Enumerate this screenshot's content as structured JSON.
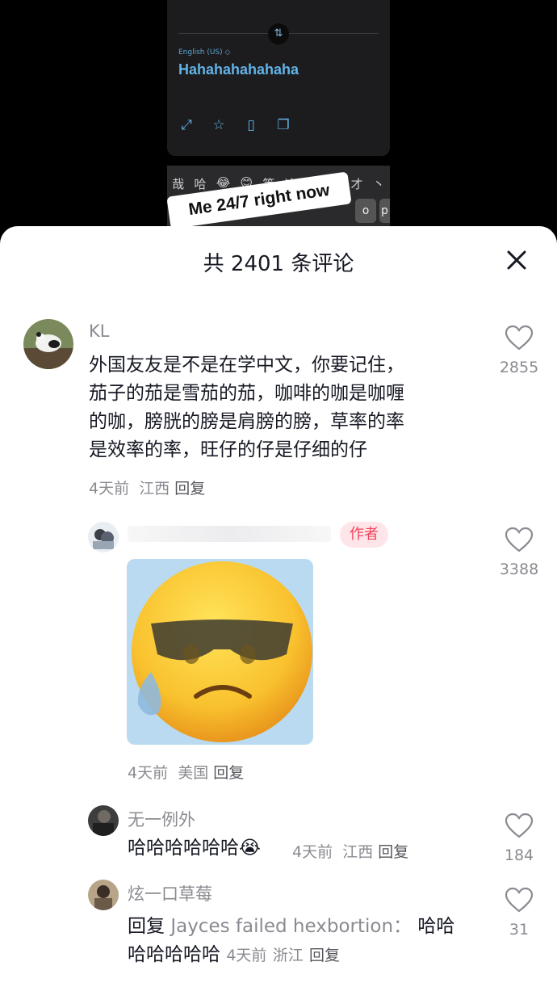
{
  "video": {
    "language_label": "English (US) ◇",
    "translated_text": "Hahahahahahaha",
    "caption": "Me 24/7 right now",
    "keyboard_candidates": [
      "哉",
      "哈",
      "😂",
      "😊",
      "等",
      "这",
      "啊",
      "你",
      "才",
      "丶"
    ],
    "keys": [
      "o",
      "p"
    ]
  },
  "comments_sheet": {
    "title": "共 2401 条评论",
    "close_icon": "close-icon"
  },
  "comments": [
    {
      "username": "KL",
      "text": "外国友友是不是在学中文，你要记住，茄子的茄是雪茄的茄，咖啡的咖是咖喱的咖，膀胱的膀是肩膀的膀，草率的率是效率的率，旺仔的仔是仔细的仔",
      "lines": [
        "外国友友是不是在学中文，你要记住，",
        "茄子的茄是雪茄的茄，咖啡的咖是咖喱",
        "的咖，膀胱的膀是肩膀的膀，草率的率",
        "是效率的率，旺仔的仔是仔细的仔"
      ],
      "time": "4天前",
      "location": "江西",
      "reply": "回复",
      "likes": "2855"
    },
    {
      "username": "",
      "badge": "作者",
      "sticker": "crying-sunglasses-emoji",
      "time": "4天前",
      "location": "美国",
      "reply": "回复",
      "likes": "3388"
    },
    {
      "username": "无一例外",
      "text": "哈哈哈哈哈哈",
      "emoji": "😭",
      "time": "4天前",
      "location": "江西",
      "reply": "回复",
      "likes": "184"
    },
    {
      "username": "炫一口草莓",
      "reply_prefix": "回复",
      "reply_to": "Jayces failed hexbortion：",
      "text_part1": "哈哈",
      "text_part2": "哈哈哈哈哈",
      "time": "4天前",
      "location": "浙江",
      "reply": "回复",
      "likes": "31"
    }
  ],
  "colors": {
    "badge_bg": "#fde5e9",
    "badge_text": "#f2455d",
    "muted": "#8a8b91",
    "text": "#161823"
  }
}
